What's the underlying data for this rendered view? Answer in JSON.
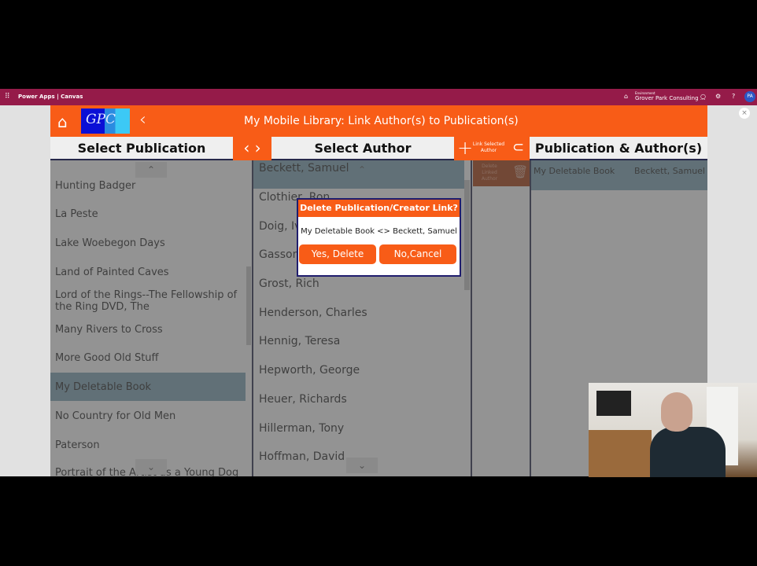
{
  "topbar": {
    "waffle_icon": "⠿",
    "brand": "Power Apps  |  Canvas",
    "environment_label": "Environment",
    "environment_name": "Grover Park Consulting ...",
    "notification_icon": "🔔",
    "settings_icon": "⚙",
    "help_icon": "?",
    "avatar_initials": "PA"
  },
  "close_icon": "×",
  "header": {
    "home_icon": "⌂",
    "logo_text": "GPC",
    "back_icon": "‹",
    "title": "My Mobile Library:  Link Author(s) to Publication(s)"
  },
  "columns": {
    "publication": "Select Publication",
    "author": "Select Author",
    "linked": "Publication & Author(s)"
  },
  "nav_arrows": "‹ ›",
  "link_button": {
    "plus": "+",
    "label": "Link Selected Author",
    "clip_icon": "📎"
  },
  "delete_button": {
    "label": "Delete Linked Author",
    "trash_icon": "🗑"
  },
  "publications": {
    "items": [
      "Hunting Badger",
      "La Peste",
      "Lake Woebegon Days",
      "Land of Painted Caves",
      "Lord of the Rings--The Fellowship of the Ring DVD, The",
      "Many Rivers to Cross",
      "More Good Old Stuff",
      "My Deletable Book",
      "No Country for Old Men",
      "Paterson",
      "Portrait of the Artist as a Young Dog"
    ],
    "selected": "My Deletable Book",
    "chevron_up": "⌃",
    "chevron_down": "⌄"
  },
  "authors": {
    "items": [
      "Beckett, Samuel",
      "Clothier, Ron",
      "Doig, Ivan",
      "Gasson",
      "Grost, Rich",
      "Henderson, Charles",
      "Hennig, Teresa",
      "Hepworth, George",
      "Heuer, Richards",
      "Hillerman, Tony",
      "Hoffman, David"
    ],
    "selected": "Beckett, Samuel",
    "chevron_up": "⌃",
    "chevron_down": "⌄"
  },
  "linked": {
    "rows": [
      {
        "book": "My Deletable Book",
        "author": "Beckett, Samuel"
      }
    ]
  },
  "dialog": {
    "title": "Delete Publication/Creator Link?",
    "message": "My Deletable Book <> Beckett, Samuel",
    "yes_label": "Yes, Delete",
    "no_label": "No,Cancel"
  },
  "colors": {
    "accent": "#f85c17",
    "topbar": "#951b49",
    "selection": "#7ba4b6",
    "dialog_border": "#1f1d6e"
  }
}
